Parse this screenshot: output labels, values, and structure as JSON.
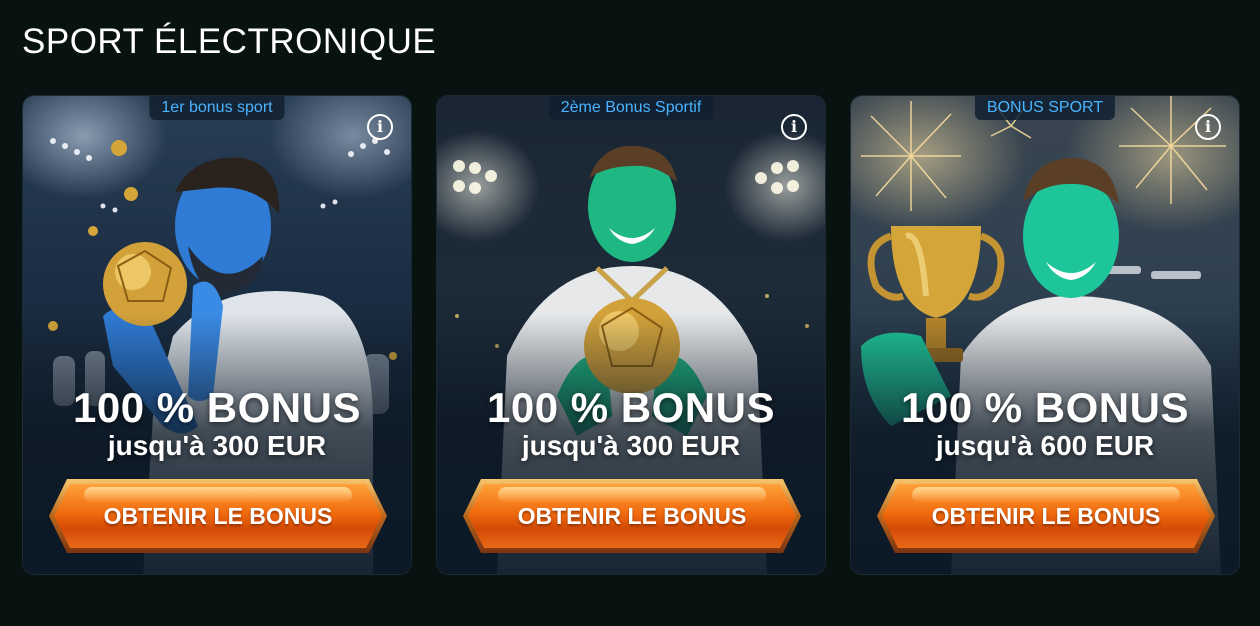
{
  "section": {
    "title": "SPORT ÉLECTRONIQUE"
  },
  "cards": [
    {
      "badge": "1er bonus sport",
      "headline": "100 % BONUS",
      "subline": "jusqu'à 300 EUR",
      "cta": "OBTENIR LE BONUS",
      "info_icon": "i",
      "skin_color": "#2f7bd6"
    },
    {
      "badge": "2ème Bonus Sportif",
      "headline": "100 % BONUS",
      "subline": "jusqu'à 300 EUR",
      "cta": "OBTENIR LE BONUS",
      "info_icon": "i",
      "skin_color": "#1fb882"
    },
    {
      "badge": "BONUS SPORT",
      "headline": "100 % BONUS",
      "subline": "jusqu'à 600 EUR",
      "cta": "OBTENIR LE BONUS",
      "info_icon": "i",
      "skin_color": "#1fc59a"
    }
  ],
  "colors": {
    "page_bg": "#081211",
    "badge_text": "#4ab3ff",
    "cta_orange": "#f06b0e",
    "gold": "#d4a63a"
  }
}
